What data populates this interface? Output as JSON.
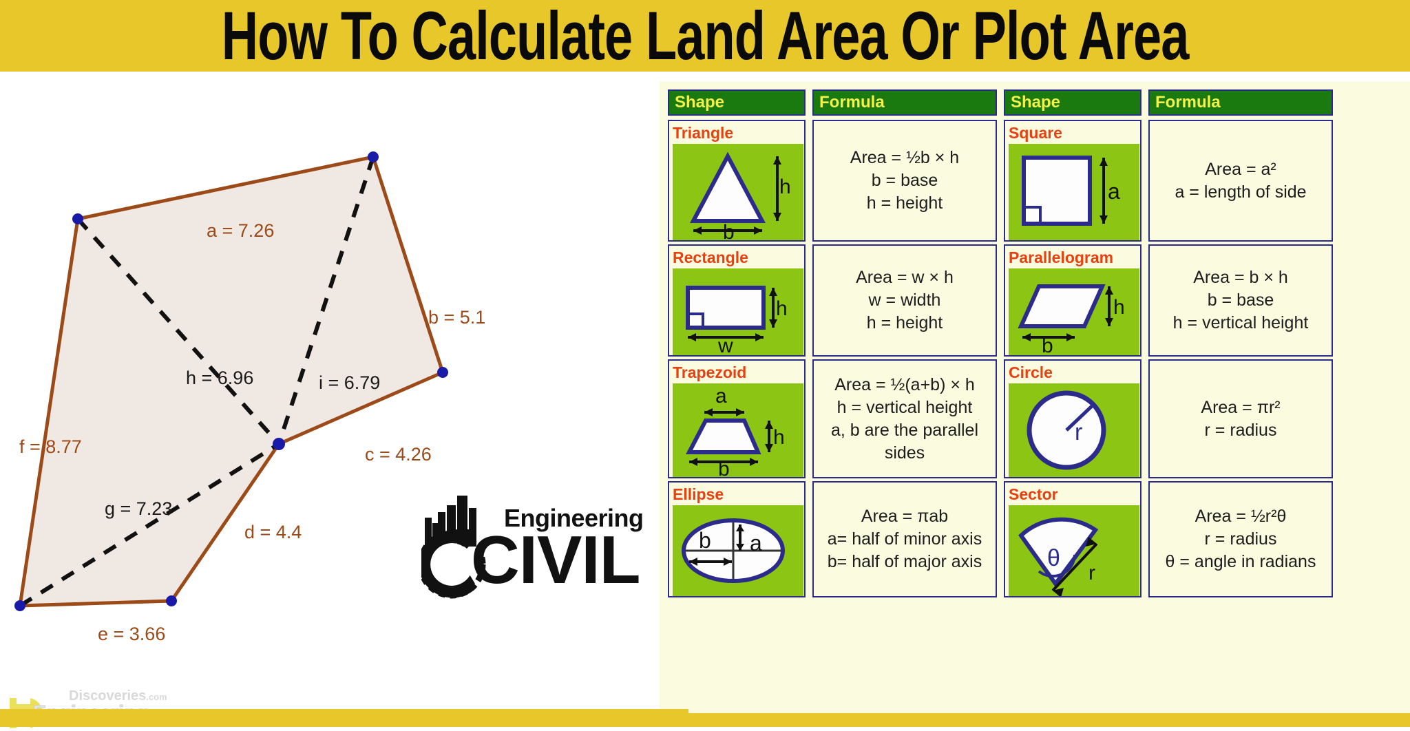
{
  "banner": {
    "title": "How To Calculate Land Area Or Plot Area",
    "background_color": "#e8c72a",
    "text_color": "#0a0a0a"
  },
  "diagram": {
    "name": "land-plot-polygon",
    "fill_color": "#f0e8e2",
    "edge_color": "#9b4a18",
    "vertex_color": "#1a1aa8",
    "diagonal_color": "#111111",
    "sides": [
      {
        "id": "a",
        "label": "a = 7.26",
        "value": 7.26,
        "type": "side"
      },
      {
        "id": "b",
        "label": "b = 5.1",
        "value": 5.1,
        "type": "side"
      },
      {
        "id": "c",
        "label": "c = 4.26",
        "value": 4.26,
        "type": "side"
      },
      {
        "id": "d",
        "label": "d = 4.4",
        "value": 4.4,
        "type": "side"
      },
      {
        "id": "e",
        "label": "e = 3.66",
        "value": 3.66,
        "type": "side"
      },
      {
        "id": "f",
        "label": "f = 8.77",
        "value": 8.77,
        "type": "side"
      }
    ],
    "diagonals": [
      {
        "id": "g",
        "label": "g = 7.23",
        "value": 7.23,
        "type": "diagonal"
      },
      {
        "id": "h",
        "label": "h = 6.96",
        "value": 6.96,
        "type": "diagonal"
      },
      {
        "id": "i",
        "label": "i = 6.79",
        "value": 6.79,
        "type": "diagonal"
      }
    ]
  },
  "logo": {
    "line1": "Engineering",
    "line2": "CIVIL"
  },
  "watermark": {
    "site": "Discoveries",
    "tld": ".com",
    "brand": "Engineering",
    "mark": "ED"
  },
  "tables": {
    "header": {
      "shape": "Shape",
      "formula": "Formula"
    },
    "header_bg": "#1a7a0f",
    "header_text_color": "#f2f24a",
    "shape_name_color": "#e8400f",
    "shape_canvas_color": "#8cc513",
    "cell_bg": "#fbfbe0",
    "border_color": "#2b2b8c",
    "left_column": [
      {
        "shape": "Triangle",
        "icon": "triangle-diagram",
        "dims": [
          "h",
          "b"
        ],
        "formula_lines": [
          "Area = ½b × h",
          "b = base",
          "h = height"
        ]
      },
      {
        "shape": "Rectangle",
        "icon": "rectangle-diagram",
        "dims": [
          "h",
          "w"
        ],
        "formula_lines": [
          "Area = w × h",
          "w = width",
          "h = height"
        ]
      },
      {
        "shape": "Trapezoid",
        "icon": "trapezoid-diagram",
        "dims": [
          "a",
          "h",
          "b"
        ],
        "formula_lines": [
          "Area = ½(a+b) × h",
          "h = vertical height",
          "a, b are the parallel sides"
        ]
      },
      {
        "shape": "Ellipse",
        "icon": "ellipse-diagram",
        "dims": [
          "b",
          "a"
        ],
        "formula_lines": [
          "Area = πab",
          "a= half of minor axis",
          "b= half of major axis"
        ]
      }
    ],
    "right_column": [
      {
        "shape": "Square",
        "icon": "square-diagram",
        "dims": [
          "a"
        ],
        "formula_lines": [
          "Area = a²",
          "a = length of side"
        ]
      },
      {
        "shape": "Parallelogram",
        "icon": "parallelogram-diagram",
        "dims": [
          "h",
          "b"
        ],
        "formula_lines": [
          "Area = b × h",
          "b = base",
          "h = vertical height"
        ]
      },
      {
        "shape": "Circle",
        "icon": "circle-diagram",
        "dims": [
          "r"
        ],
        "formula_lines": [
          "Area = πr²",
          "r = radius"
        ]
      },
      {
        "shape": "Sector",
        "icon": "sector-diagram",
        "dims": [
          "θ",
          "r"
        ],
        "formula_lines": [
          "Area = ½r²θ",
          "r = radius",
          "θ = angle in radians"
        ]
      }
    ]
  }
}
